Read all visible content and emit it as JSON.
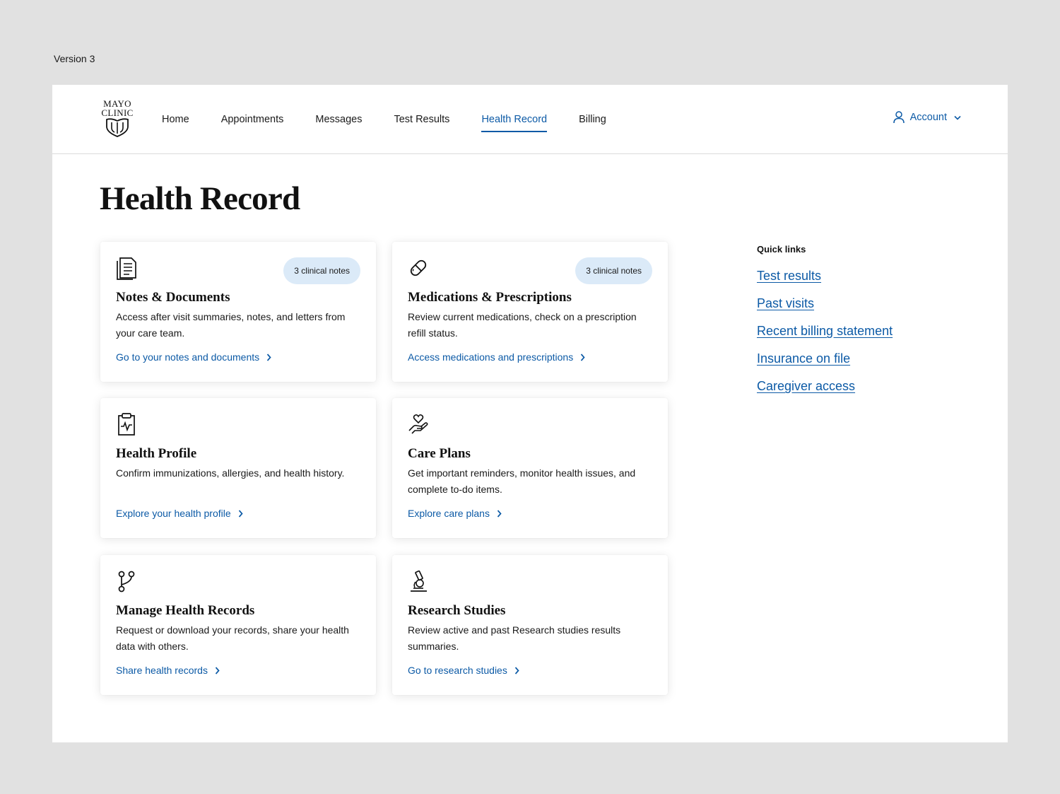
{
  "version_label": "Version 3",
  "logo": {
    "line1": "MAYO",
    "line2": "CLINIC"
  },
  "nav": {
    "items": [
      {
        "label": "Home"
      },
      {
        "label": "Appointments"
      },
      {
        "label": "Messages"
      },
      {
        "label": "Test Results"
      },
      {
        "label": "Health Record",
        "active": true
      },
      {
        "label": "Billing"
      }
    ],
    "account_label": "Account"
  },
  "page_title": "Health Record",
  "cards": [
    {
      "icon": "document-icon",
      "badge": "3 clinical notes",
      "title": "Notes & Documents",
      "description": "Access after visit summaries, notes, and letters from your care team.",
      "link": "Go to your notes and documents"
    },
    {
      "icon": "pill-icon",
      "badge": "3 clinical notes",
      "title": "Medications & Prescriptions",
      "description": "Review current medications, check on a prescription refill status.",
      "link": "Access medications and prescriptions"
    },
    {
      "icon": "clipboard-pulse-icon",
      "title": "Health Profile",
      "description": "Confirm immunizations, allergies, and health history.",
      "link": "Explore your health profile"
    },
    {
      "icon": "heart-hand-icon",
      "title": "Care Plans",
      "description": "Get important reminders, monitor health issues, and complete to-do items.",
      "link": "Explore care plans"
    },
    {
      "icon": "share-branch-icon",
      "title": "Manage Health Records",
      "description": "Request or download your records, share your health data with others.",
      "link": "Share health records"
    },
    {
      "icon": "microscope-icon",
      "title": "Research Studies",
      "description": "Review active and past Research studies results summaries.",
      "link": "Go to research studies"
    }
  ],
  "quick_links": {
    "heading": "Quick links",
    "items": [
      "Test results",
      "Past visits",
      "Recent billing statement",
      "Insurance on file",
      "Caregiver access"
    ]
  },
  "colors": {
    "accent": "#0c5aa6",
    "badge_bg": "#dbeaf8",
    "page_bg": "#e1e1e1"
  }
}
